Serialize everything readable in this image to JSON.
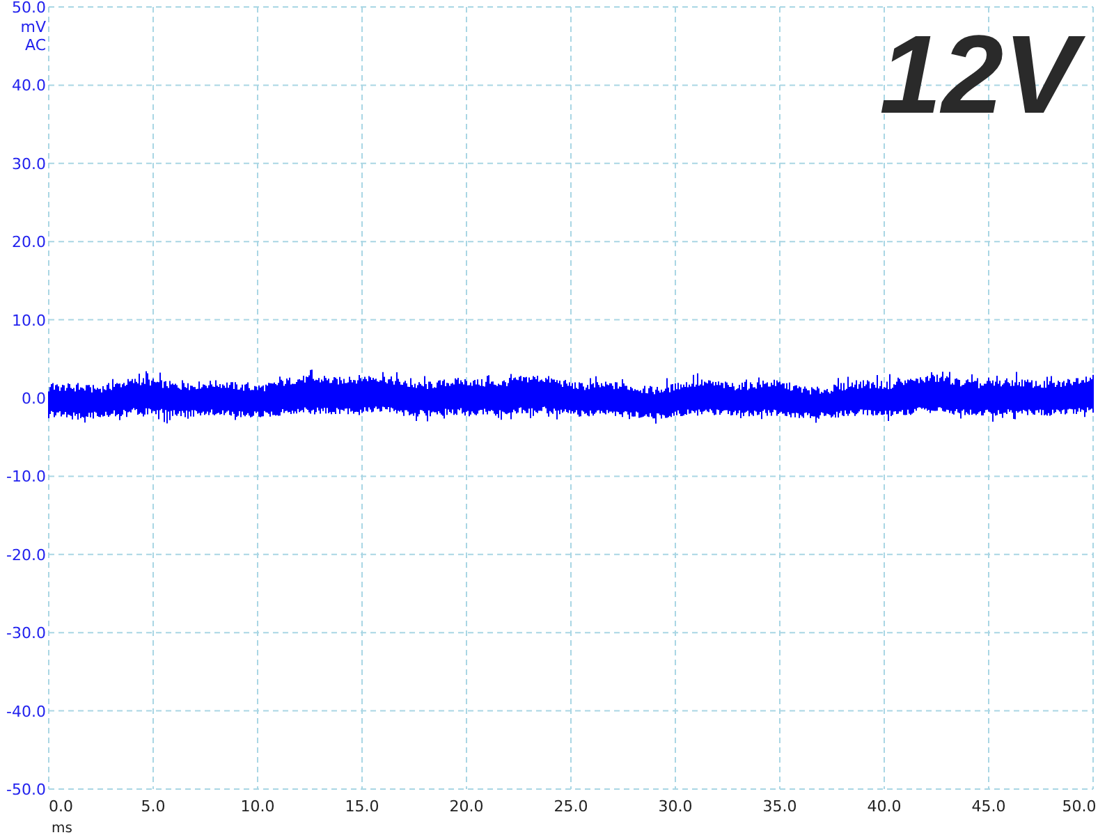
{
  "plot": {
    "y_unit": "mV",
    "coupling": "AC",
    "x_unit": "ms",
    "y_ticks": [
      "50.0",
      "40.0",
      "30.0",
      "20.0",
      "10.0",
      "0.0",
      "-10.0",
      "-20.0",
      "-30.0",
      "-40.0",
      "-50.0"
    ],
    "x_ticks": [
      "0.0",
      "5.0",
      "10.0",
      "15.0",
      "20.0",
      "25.0",
      "30.0",
      "35.0",
      "40.0",
      "45.0",
      "50.0"
    ],
    "overlay": "12V"
  }
}
